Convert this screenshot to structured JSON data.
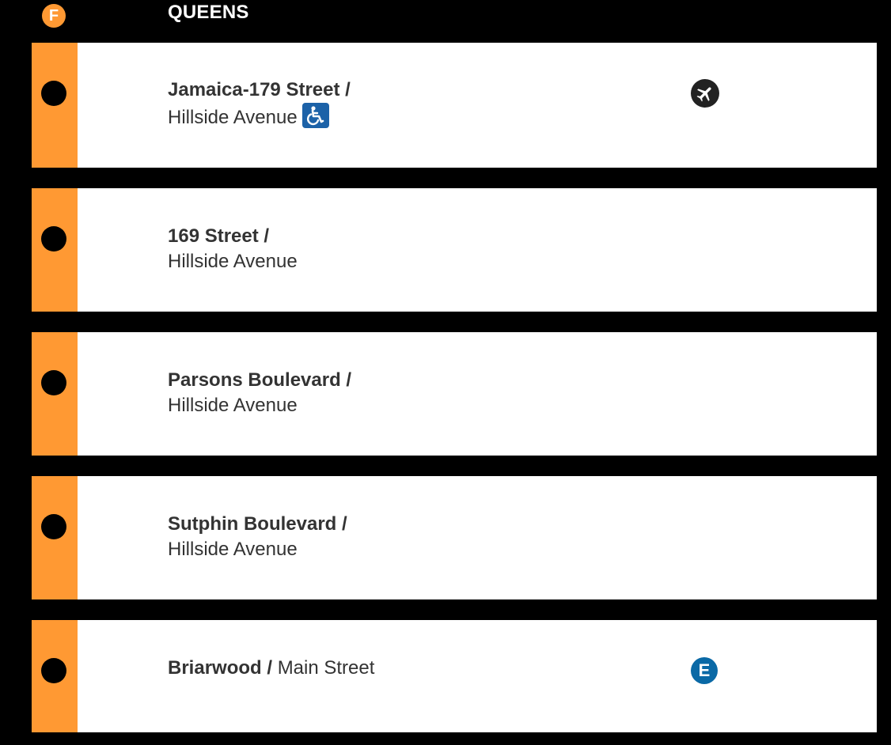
{
  "header": {
    "route": "F",
    "borough": "QUEENS"
  },
  "colors": {
    "route": "#ff9933",
    "background": "#000000",
    "card": "#ffffff",
    "ada": "#1c62a8",
    "transfer_e": "#0a69a6"
  },
  "stops": [
    {
      "primary": "Jamaica-179 Street /",
      "secondary": "Hillside Avenue",
      "accessible": true,
      "icons": [
        "wheelchair-icon",
        "airport-icon"
      ]
    },
    {
      "primary": "169 Street /",
      "secondary": "Hillside Avenue",
      "icons": []
    },
    {
      "primary": "Parsons Boulevard /",
      "secondary": "Hillside Avenue",
      "icons": []
    },
    {
      "primary": "Sutphin Boulevard /",
      "secondary": "Hillside Avenue",
      "icons": []
    },
    {
      "primary": "Briarwood /",
      "secondary": "Main Street",
      "transfers": [
        "E"
      ],
      "icons": [
        "e-train-icon"
      ]
    }
  ]
}
